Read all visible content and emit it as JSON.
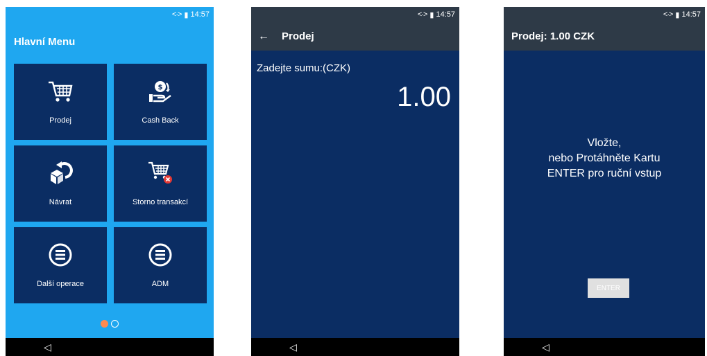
{
  "status": {
    "sync_icon": "<·>",
    "battery_icon": "▮",
    "time": "14:57"
  },
  "screen1": {
    "title": "Hlavní Menu",
    "tiles": [
      {
        "label": "Prodej",
        "icon": "cart-icon"
      },
      {
        "label": "Cash Back",
        "icon": "cash-back-icon"
      },
      {
        "label": "Návrat",
        "icon": "return-box-icon"
      },
      {
        "label": "Storno transakcí",
        "icon": "cart-cancel-icon"
      },
      {
        "label": "Další operace",
        "icon": "menu-circle-icon"
      },
      {
        "label": "ADM",
        "icon": "menu-circle-icon"
      }
    ],
    "page_dots": {
      "active": 1,
      "total": 2
    }
  },
  "screen2": {
    "back_label": "←",
    "title": "Prodej",
    "prompt": "Zadejte sumu:(CZK)",
    "amount": "1.00"
  },
  "screen3": {
    "title": "Prodej: 1.00 CZK",
    "message_line1": "Vložte,",
    "message_line2": "nebo Protáhněte Kartu",
    "message_line3": "ENTER pro ruční vstup",
    "enter_label": "ENTER"
  },
  "navbar": {
    "back_label": "◁"
  },
  "colors": {
    "menu_bg": "#1fa7f0",
    "tile_bg": "#0b2d63",
    "bar_bg": "#2e3a47",
    "accent_dot": "#ff8a50"
  }
}
